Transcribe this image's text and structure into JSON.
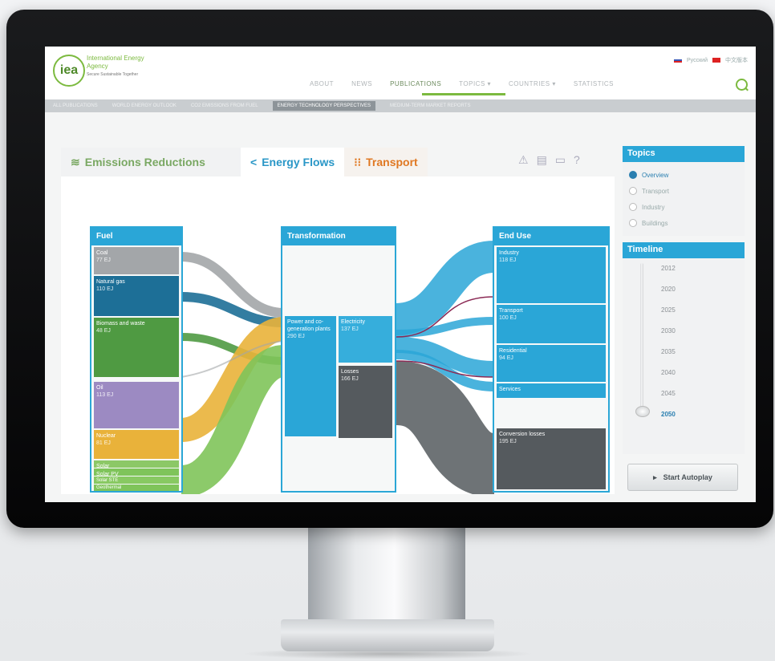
{
  "header": {
    "org_name": "International Energy Agency",
    "tagline": "Secure Sustainable Together",
    "logo_text": "iea",
    "languages": [
      "Русский",
      "中文版本"
    ],
    "nav": [
      "ABOUT",
      "NEWS",
      "PUBLICATIONS",
      "TOPICS ▾",
      "COUNTRIES ▾",
      "STATISTICS"
    ],
    "active_nav": "PUBLICATIONS",
    "subnav": [
      "ALL PUBLICATIONS",
      "WORLD ENERGY OUTLOOK",
      "CO2 EMISSIONS FROM FUEL",
      "ENERGY TECHNOLOGY PERSPECTIVES",
      "MEDIUM-TERM MARKET REPORTS"
    ],
    "active_subnav": "ENERGY TECHNOLOGY PERSPECTIVES"
  },
  "tabs": {
    "emissions": "Emissions Reductions",
    "flows": "Energy Flows",
    "transport": "Transport"
  },
  "sankey": {
    "fuel": {
      "title": "Fuel",
      "items": [
        {
          "label": "Coal",
          "value": "77 EJ"
        },
        {
          "label": "Natural gas",
          "value": "110 EJ"
        },
        {
          "label": "Biomass and waste",
          "value": "48 EJ"
        },
        {
          "label": "Oil",
          "value": "113 EJ"
        },
        {
          "label": "Nuclear",
          "value": "81 EJ"
        },
        {
          "label": "Solar",
          "value": ""
        },
        {
          "label": "Solar PV",
          "value": ""
        },
        {
          "label": "Solar STE",
          "value": ""
        },
        {
          "label": "Geothermal",
          "value": ""
        }
      ]
    },
    "transformation": {
      "title": "Transformation",
      "power": {
        "label": "Power and co-generation plants",
        "value": "290 EJ"
      },
      "electricity": {
        "label": "Electricity",
        "value": "137 EJ"
      },
      "losses": {
        "label": "Losses",
        "value": "166 EJ"
      }
    },
    "enduse": {
      "title": "End Use",
      "items": [
        {
          "label": "Industry",
          "value": "118 EJ"
        },
        {
          "label": "Transport",
          "value": "100 EJ"
        },
        {
          "label": "Residential",
          "value": "94 EJ"
        },
        {
          "label": "Services",
          "value": ""
        },
        {
          "label": "Conversion losses",
          "value": "195 EJ"
        }
      ]
    }
  },
  "topics": {
    "title": "Topics",
    "options": [
      "Overview",
      "Transport",
      "Industry",
      "Buildings"
    ],
    "selected": "Overview"
  },
  "timeline": {
    "title": "Timeline",
    "years": [
      "2012",
      "2020",
      "2025",
      "2030",
      "2035",
      "2040",
      "2045",
      "2050"
    ],
    "selected": "2050",
    "autoplay_label": "Start Autoplay"
  },
  "colors": {
    "accent": "#2aa6d7",
    "green": "#7cba3f",
    "coal": "#a3a6a9",
    "gas": "#1d6f97",
    "biomass": "#4f9a42",
    "oil": "#9c8ac2",
    "nuclear": "#e9b23a",
    "renewables": "#7fc45a",
    "electricity": "#2aa6d7",
    "losses": "#555a5e"
  }
}
